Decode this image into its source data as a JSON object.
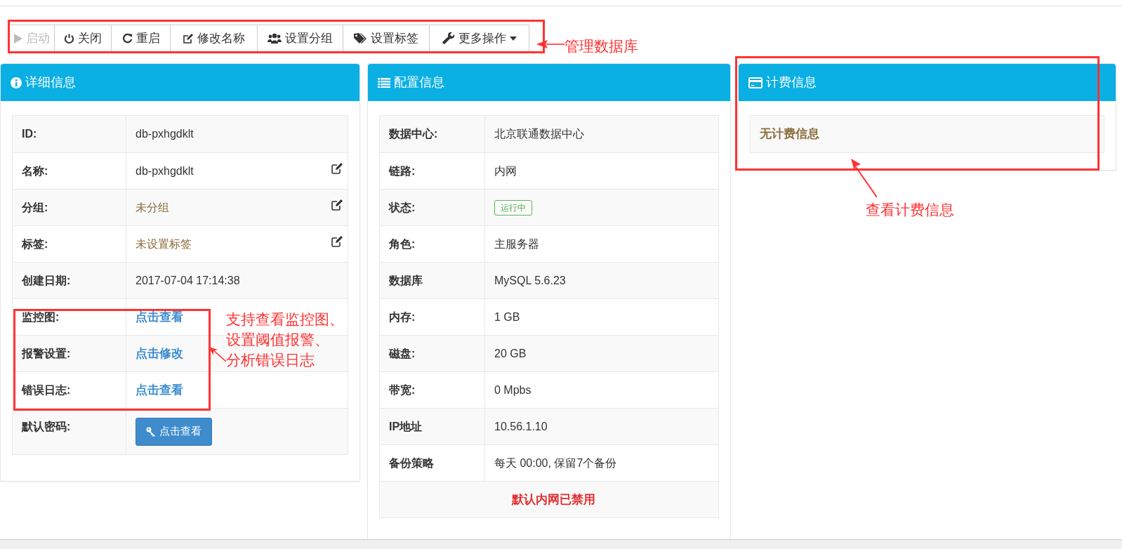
{
  "toolbar": {
    "buttons": [
      {
        "label": "启动",
        "kind": "play",
        "disabled": true,
        "has_menu": false
      },
      {
        "label": "关闭",
        "kind": "power",
        "disabled": false,
        "has_menu": false
      },
      {
        "label": "重启",
        "kind": "restart",
        "disabled": false,
        "has_menu": false
      },
      {
        "label": "修改名称",
        "kind": "edit",
        "disabled": false,
        "has_menu": false
      },
      {
        "label": "设置分组",
        "kind": "users",
        "disabled": false,
        "has_menu": false
      },
      {
        "label": "设置标签",
        "kind": "tags",
        "disabled": false,
        "has_menu": false
      },
      {
        "label": "更多操作",
        "kind": "wrench",
        "disabled": false,
        "has_menu": true
      }
    ]
  },
  "panels": [
    {
      "title": "详细信息",
      "kind": "info",
      "rows": [
        {
          "label": "ID:",
          "value": "db-pxhgdklt",
          "kind": "text",
          "editable": false
        },
        {
          "label": "名称:",
          "value": "db-pxhgdklt",
          "kind": "text",
          "editable": true
        },
        {
          "label": "分组:",
          "value": "未分组",
          "kind": "muted",
          "editable": true
        },
        {
          "label": "标签:",
          "value": "未设置标签",
          "kind": "muted",
          "editable": true
        },
        {
          "label": "创建日期:",
          "value": "2017-07-04 17:14:38",
          "kind": "text",
          "editable": false
        },
        {
          "label": "监控图:",
          "value": "点击查看",
          "kind": "link",
          "editable": false
        },
        {
          "label": "报警设置:",
          "value": "点击修改",
          "kind": "link",
          "editable": false
        },
        {
          "label": "错误日志:",
          "value": "点击查看",
          "kind": "link",
          "editable": false
        },
        {
          "label": "默认密码:",
          "value": "点击查看",
          "kind": "button",
          "editable": false
        }
      ]
    },
    {
      "title": "配置信息",
      "kind": "list",
      "rows": [
        {
          "label": "数据中心:",
          "value": "北京联通数据中心",
          "kind": "text"
        },
        {
          "label": "链路:",
          "value": "内网",
          "kind": "text"
        },
        {
          "label": "状态:",
          "value": "运行中",
          "kind": "badge"
        },
        {
          "label": "角色:",
          "value": "主服务器",
          "kind": "text"
        },
        {
          "label": "数据库",
          "value": "MySQL 5.6.23",
          "kind": "text"
        },
        {
          "label": "内存:",
          "value": "1 GB",
          "kind": "text"
        },
        {
          "label": "磁盘:",
          "value": "20 GB",
          "kind": "text"
        },
        {
          "label": "带宽:",
          "value": "0 Mpbs",
          "kind": "text"
        },
        {
          "label": "IP地址",
          "value": "10.56.1.10",
          "kind": "text"
        },
        {
          "label": "备份策略",
          "value": "每天 00:00, 保留7个备份",
          "kind": "text"
        },
        {
          "value": "默认内网已禁用",
          "kind": "notice"
        }
      ]
    },
    {
      "title": "计费信息",
      "kind": "billing",
      "rows": [
        {
          "value": "无计费信息",
          "kind": "empty"
        }
      ]
    }
  ],
  "annotations": [
    {
      "text": "管理数据库"
    },
    {
      "text": "支持查看监控图、设置阈值报警、分析错误日志"
    },
    {
      "text": "查看计费信息"
    }
  ]
}
